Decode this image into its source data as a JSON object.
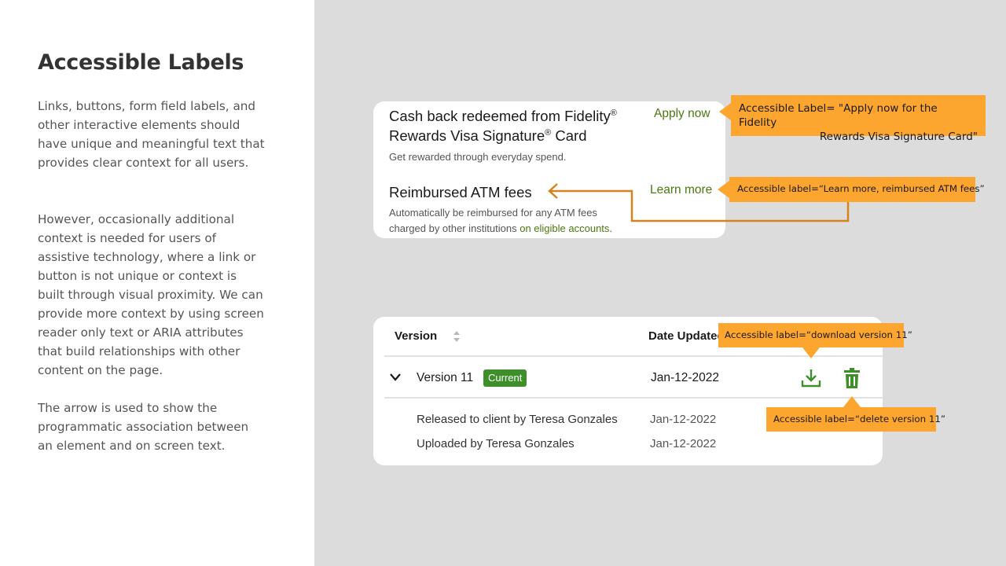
{
  "page": {
    "title": "Accessible Labels",
    "paragraphs": [
      "Links, buttons, form field labels, and other interactive elements should have unique and meaningful text that provides clear context for all users.",
      "However, occasionally additional context is needed for users of assistive technology, where a link or button is not unique or context is built through visual proximity. We can provide more context by using screen reader only text or ARIA attributes that build relationships with other content on the page.",
      "The arrow is used to show the programmatic association between an element and on screen text."
    ]
  },
  "offers": {
    "offer1": {
      "title_part1": "Cash back redeemed from Fidelity",
      "title_reg1": "®",
      "title_part2": "Rewards Visa Signature",
      "title_reg2": "®",
      "title_part3": " Card",
      "description": "Get rewarded through everyday spend.",
      "link": "Apply now"
    },
    "offer2": {
      "title": "Reimbursed ATM fees",
      "description_line1": "Automatically be reimbursed for any ATM fees",
      "description_line2": "charged by other institutions ",
      "inline_link": "on eligible accounts",
      "description_end": ".",
      "link": "Learn more"
    }
  },
  "callouts": {
    "apply_line1": "Accessible Label= \"Apply now for the Fidelity",
    "apply_line2": "Rewards Visa Signature Card\"",
    "learn": "Accessible label=“Learn more, reimbursed ATM fees”",
    "download": "Accessible label=“download version 11”",
    "delete": "Accessible label=“delete version 11”"
  },
  "table": {
    "headers": {
      "version": "Version",
      "date": "Date Updated"
    },
    "row": {
      "version": "Version 11",
      "badge": "Current",
      "date": "Jan-12-2022"
    },
    "details": [
      {
        "text": "Released to client by Teresa Gonzales",
        "date": "Jan-12-2022"
      },
      {
        "text": "Uploaded by Teresa Gonzales",
        "date": "Jan-12-2022"
      }
    ]
  },
  "colors": {
    "accent_orange": "#fca52f",
    "connector_orange": "#d4841c",
    "link_green": "#4a7a10",
    "badge_green": "#3e8e2a",
    "icon_green": "#3e8e2a",
    "right_panel_bg": "#dcdcdc"
  },
  "icons": {
    "sort": "sort-icon",
    "expand": "chevron-down-icon",
    "download": "download-icon",
    "delete": "trash-icon"
  }
}
